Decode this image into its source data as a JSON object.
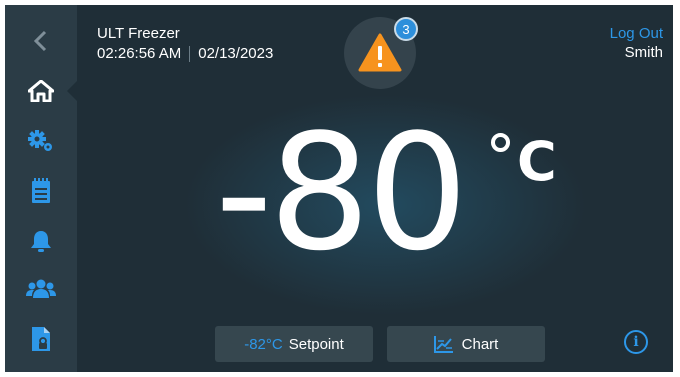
{
  "header": {
    "device_name": "ULT Freezer",
    "time": "02:26:56 AM",
    "date": "02/13/2023"
  },
  "alerts": {
    "count": "3",
    "icon": "warning-triangle-icon"
  },
  "user": {
    "logout_label": "Log Out",
    "name": "Smith"
  },
  "reading": {
    "temperature": "-80",
    "unit": "C"
  },
  "actions": {
    "setpoint_value": "-82°C",
    "setpoint_label": "Setpoint",
    "chart_label": "Chart",
    "info_label": "i"
  },
  "sidebar": {
    "items": [
      {
        "icon": "back-chevron-icon"
      },
      {
        "icon": "home-icon",
        "active": true
      },
      {
        "icon": "settings-gears-icon"
      },
      {
        "icon": "clipboard-icon"
      },
      {
        "icon": "bell-icon"
      },
      {
        "icon": "users-icon"
      },
      {
        "icon": "secure-document-icon"
      }
    ]
  },
  "colors": {
    "background": "#1f2e37",
    "sidebar": "#2b3c46",
    "accent": "#2d97e8",
    "warning": "#f7931e"
  }
}
